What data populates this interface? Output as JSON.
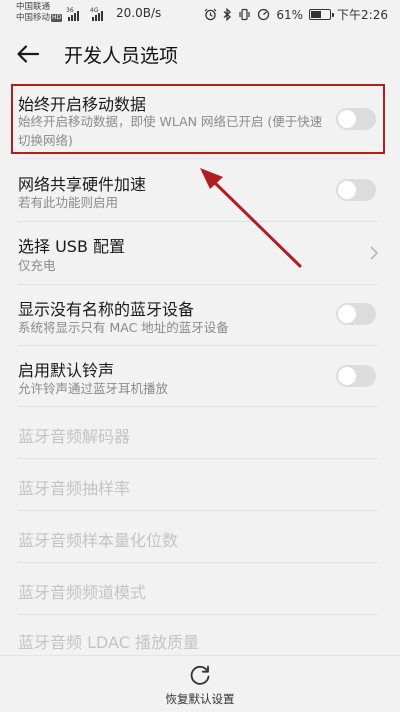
{
  "status_bar": {
    "carrier_1": "中国联通",
    "carrier_2": "中国移动",
    "hd_badge": "HD",
    "network_1": "36",
    "network_2": "4G",
    "net_speed": "20.0B/s",
    "battery_percent": "61%",
    "battery_level": 0.61,
    "time": "下午2:26"
  },
  "header": {
    "title": "开发人员选项"
  },
  "settings": [
    {
      "title": "始终开启移动数据",
      "subtitle": "始终开启移动数据，即使 WLAN 网络已开启 (便于快速切换网络)",
      "control": "toggle",
      "checked": false,
      "enabled": true
    },
    {
      "title": "网络共享硬件加速",
      "subtitle": "若有此功能则启用",
      "control": "toggle",
      "checked": false,
      "enabled": true
    },
    {
      "title": "选择 USB 配置",
      "subtitle": "仅充电",
      "control": "chevron",
      "enabled": true
    },
    {
      "title": "显示没有名称的蓝牙设备",
      "subtitle": "系统将显示只有 MAC 地址的蓝牙设备",
      "control": "toggle",
      "checked": false,
      "enabled": true
    },
    {
      "title": "启用默认铃声",
      "subtitle": "允许铃声通过蓝牙耳机播放",
      "control": "toggle",
      "checked": false,
      "enabled": true
    },
    {
      "title": "蓝牙音频解码器",
      "enabled": false
    },
    {
      "title": "蓝牙音频抽样率",
      "enabled": false
    },
    {
      "title": "蓝牙音频样本量化位数",
      "enabled": false
    },
    {
      "title": "蓝牙音频频道模式",
      "enabled": false
    },
    {
      "title": "蓝牙音频 LDAC 播放质量",
      "enabled": false
    }
  ],
  "bottom": {
    "reset_label": "恢复默认设置"
  },
  "annotation": {
    "color": "#b01e23"
  },
  "icons": {
    "back": "back-arrow-icon",
    "reset": "refresh-icon",
    "chevron": "chevron-right-icon"
  }
}
